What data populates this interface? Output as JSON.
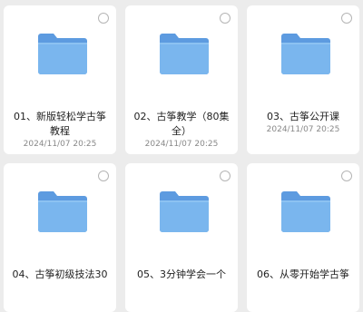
{
  "files": [
    {
      "name_line1": "01、新版轻松学古筝",
      "name_line2": "教程",
      "date": "2024/11/07 20:25"
    },
    {
      "name_line1": "02、古筝教学（80集",
      "name_line2": "全）",
      "date": "2024/11/07 20:25"
    },
    {
      "name_line1": "03、古筝公开课",
      "name_line2": "",
      "date": "2024/11/07 20:25"
    },
    {
      "name_line1": "04、古筝初级技法30",
      "name_line2": "",
      "date": ""
    },
    {
      "name_line1": "05、3分钟学会一个",
      "name_line2": "",
      "date": ""
    },
    {
      "name_line1": "06、从零开始学古筝",
      "name_line2": "",
      "date": ""
    }
  ],
  "colors": {
    "folder_front": "#7ab6ee",
    "folder_back": "#5d9be0",
    "folder_tab": "#4f8dd6"
  }
}
